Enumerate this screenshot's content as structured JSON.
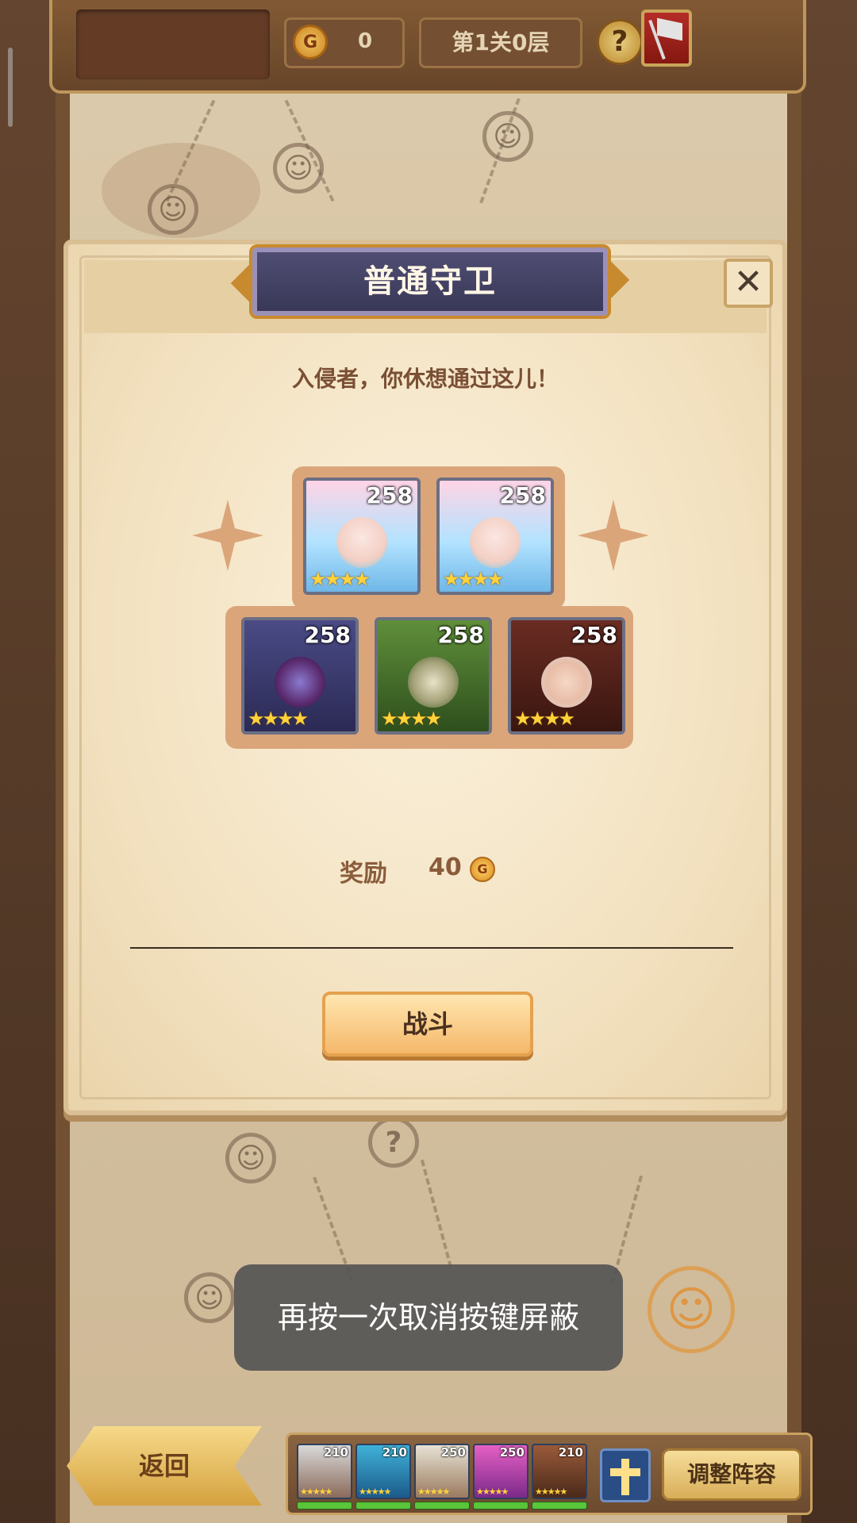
{
  "topbar": {
    "coin_count": "0",
    "level_text": "第1关0层",
    "help_symbol": "?"
  },
  "dialog": {
    "title": "普通守卫",
    "close_symbol": "✕",
    "subtitle": "入侵者，你休想通过这儿！",
    "enemies": [
      {
        "level": "258",
        "stars": "★★★★"
      },
      {
        "level": "258",
        "stars": "★★★★"
      },
      {
        "level": "258",
        "stars": "★★★★"
      },
      {
        "level": "258",
        "stars": "★★★★"
      },
      {
        "level": "258",
        "stars": "★★★★"
      }
    ],
    "reward_label": "奖励",
    "reward_value": "40",
    "fight_label": "战斗"
  },
  "toast": {
    "message": "再按一次取消按键屏蔽"
  },
  "bottom": {
    "back_label": "返回",
    "adjust_label": "调整阵容",
    "team": [
      {
        "level": "210",
        "stars": "★★★★★"
      },
      {
        "level": "210",
        "stars": "★★★★★"
      },
      {
        "level": "250",
        "stars": "★★★★★"
      },
      {
        "level": "250",
        "stars": "★★★★★"
      },
      {
        "level": "210",
        "stars": "★★★★★"
      }
    ]
  },
  "colors": {
    "dialog_bg": "#f3e2c1",
    "title_plate": "#3a3858",
    "fight_button": "#f5b86a",
    "toast_bg": "#555555"
  },
  "icons": [
    "coin-icon",
    "help-icon",
    "flag-icon",
    "close-icon",
    "cross-icon"
  ]
}
